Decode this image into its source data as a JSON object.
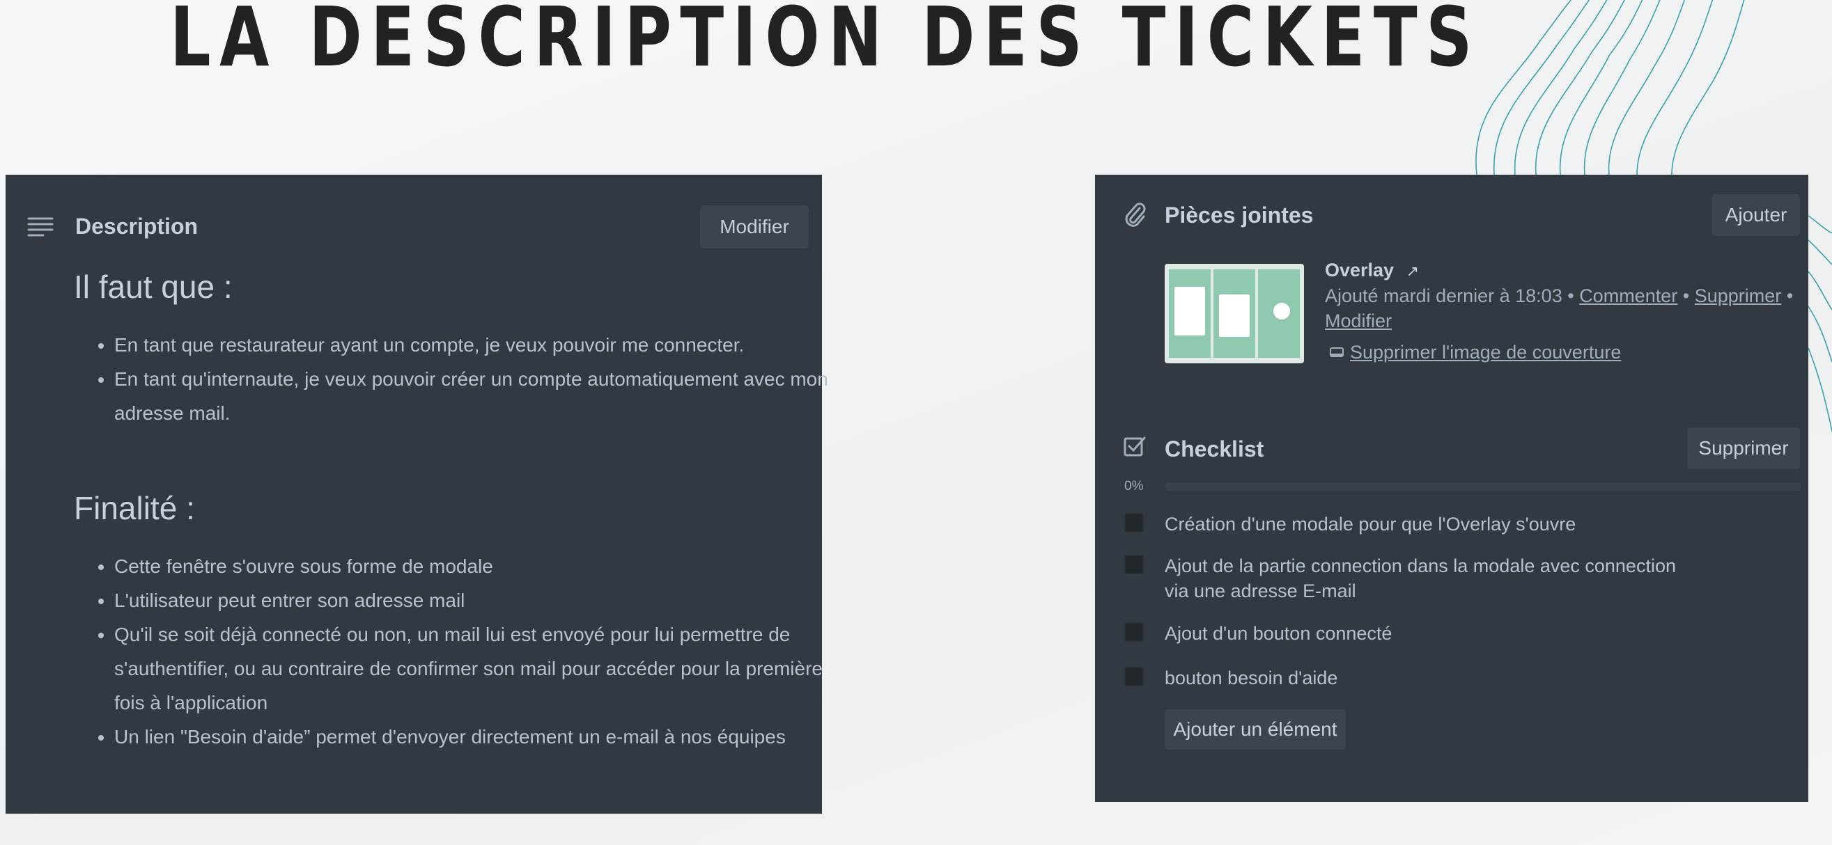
{
  "title": "LA DESCRIPTION DES TICKETS",
  "description_panel": {
    "header_title": "Description",
    "edit_button": "Modifier",
    "section1_title": "Il faut que :",
    "section1_items": [
      "En tant que restaurateur ayant un compte, je veux pouvoir me connecter.",
      "En tant qu'internaute, je veux pouvoir créer un compte automatiquement avec mon adresse mail."
    ],
    "section2_title": "Finalité :",
    "section2_items": [
      "Cette fenêtre s'ouvre sous forme de modale",
      "L'utilisateur peut entrer son adresse mail",
      "Qu'il se soit déjà connecté ou non, un mail lui est envoyé pour lui permettre de s'authentifier, ou au contraire de confirmer son mail pour accéder pour la première fois à l'application",
      "Un lien \"Besoin d'aide” permet d'envoyer directement un e-mail à nos équipes"
    ]
  },
  "attachments": {
    "header_title": "Pièces jointes",
    "add_button": "Ajouter",
    "file_name": "Overlay",
    "arrow": "↗",
    "meta_prefix": "Ajouté mardi dernier à 18:03 •",
    "comment_link": "Commenter",
    "sep1": "•",
    "delete_link": "Supprimer",
    "sep2": "•",
    "edit_link": "Modifier",
    "remove_cover_link": "Supprimer l'image de couverture"
  },
  "checklist": {
    "header_title": "Checklist",
    "delete_button": "Supprimer",
    "progress_label": "0%",
    "progress": 0,
    "items": [
      "Création d'une modale pour que l'Overlay s'ouvre",
      "Ajout de la partie connection dans la modale avec connection via une adresse E-mail",
      "Ajout d'un bouton connecté",
      "bouton besoin d'aide"
    ],
    "add_item_button": "Ajouter un élément"
  },
  "colors": {
    "panel_bg": "#333941",
    "title_color": "#222222",
    "decor_line": "#2a9aa3"
  },
  "icons": [
    "description-icon",
    "paperclip-icon",
    "checklist-icon",
    "external-link-icon",
    "card-cover-icon"
  ]
}
